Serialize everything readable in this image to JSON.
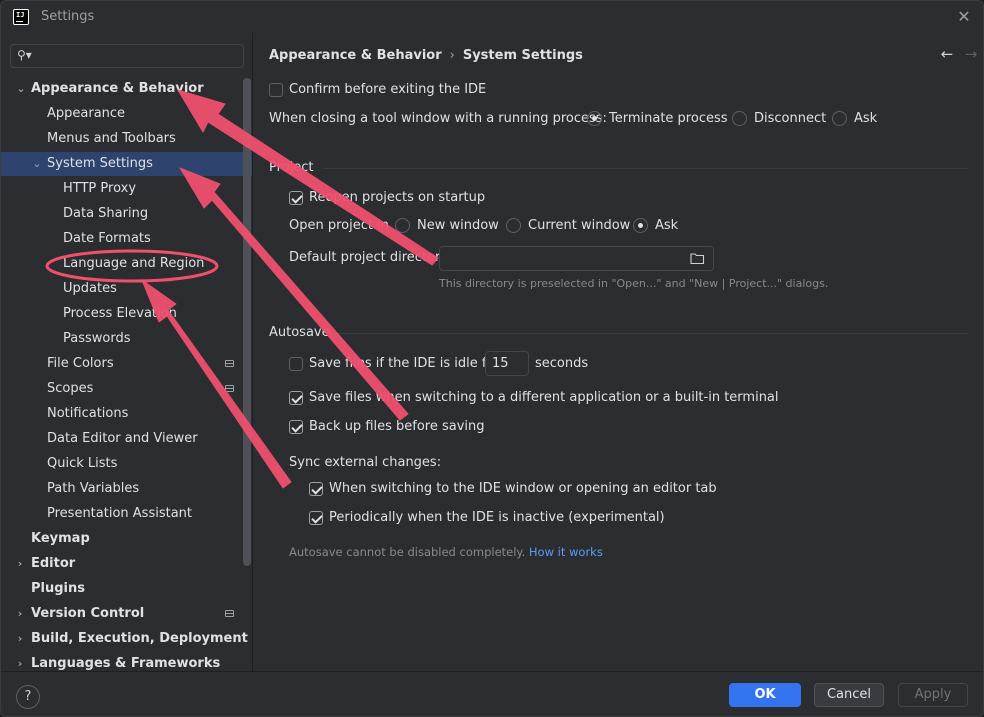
{
  "window": {
    "title": "Settings",
    "logo_text": "IJ"
  },
  "sidebar": {
    "search": {
      "value": "",
      "placeholder": ""
    },
    "items": [
      {
        "label": "Appearance & Behavior"
      },
      {
        "label": "Appearance"
      },
      {
        "label": "Menus and Toolbars"
      },
      {
        "label": "System Settings"
      },
      {
        "label": "HTTP Proxy"
      },
      {
        "label": "Data Sharing"
      },
      {
        "label": "Date Formats"
      },
      {
        "label": "Language and Region"
      },
      {
        "label": "Updates"
      },
      {
        "label": "Process Elevation"
      },
      {
        "label": "Passwords"
      },
      {
        "label": "File Colors"
      },
      {
        "label": "Scopes"
      },
      {
        "label": "Notifications"
      },
      {
        "label": "Data Editor and Viewer"
      },
      {
        "label": "Quick Lists"
      },
      {
        "label": "Path Variables"
      },
      {
        "label": "Presentation Assistant"
      },
      {
        "label": "Keymap"
      },
      {
        "label": "Editor"
      },
      {
        "label": "Plugins"
      },
      {
        "label": "Version Control"
      },
      {
        "label": "Build, Execution, Deployment"
      },
      {
        "label": "Languages & Frameworks"
      }
    ]
  },
  "breadcrumb": {
    "parent": "Appearance & Behavior",
    "separator": "›",
    "current": "System Settings"
  },
  "nav": {
    "back": "←",
    "forward": "→"
  },
  "general": {
    "confirm_exit": {
      "label": "Confirm before exiting the IDE",
      "checked": false
    },
    "tool_window_close": {
      "label": "When closing a tool window with a running process:",
      "options": [
        "Terminate process",
        "Disconnect",
        "Ask"
      ],
      "selected": "Terminate process"
    }
  },
  "project": {
    "section_title": "Project",
    "reopen": {
      "label": "Reopen projects on startup",
      "checked": true
    },
    "open_in": {
      "label": "Open project in",
      "options": [
        "New window",
        "Current window",
        "Ask"
      ],
      "selected": "Ask"
    },
    "default_dir": {
      "label": "Default project directory:",
      "value": "",
      "hint": "This directory is preselected in \"Open...\" and \"New | Project...\" dialogs."
    }
  },
  "autosave": {
    "section_title": "Autosave",
    "idle": {
      "label_before": "Save files if the IDE is idle for",
      "value": "15",
      "label_after": "seconds",
      "checked": false
    },
    "switching": {
      "label": "Save files when switching to a different application or a built-in terminal",
      "checked": true
    },
    "backup": {
      "label": "Back up files before saving",
      "checked": true
    },
    "sync_label": "Sync external changes:",
    "sync_switch": {
      "label": "When switching to the IDE window or opening an editor tab",
      "checked": true
    },
    "sync_periodic": {
      "label": "Periodically when the IDE is inactive (experimental)",
      "checked": true
    },
    "note": "Autosave cannot be disabled completely.",
    "note_link": "How it works"
  },
  "footer": {
    "help": "?",
    "ok": "OK",
    "cancel": "Cancel",
    "apply": "Apply"
  },
  "colors": {
    "accent": "#3574f0",
    "selection": "#2e436e",
    "annotation": "#f0506e"
  },
  "icons": [
    "search-icon",
    "close-icon",
    "folder-icon",
    "chevron-down-icon",
    "chevron-right-icon",
    "back-arrow-icon",
    "forward-arrow-icon",
    "help-icon"
  ]
}
